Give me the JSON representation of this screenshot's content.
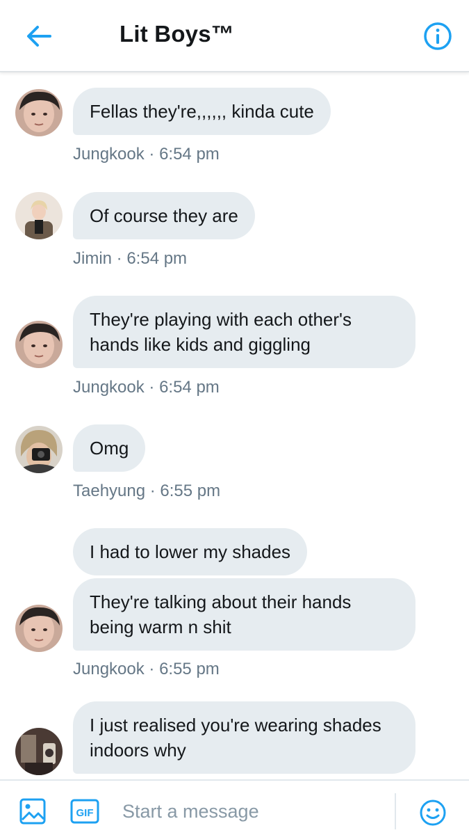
{
  "header": {
    "title": "Lit Boys™",
    "back_icon": "arrow-left-icon",
    "info_icon": "info-circle-icon",
    "accent": "#1da1f2"
  },
  "messages": [
    {
      "bubbles": [
        "Fellas they're,,,,,, kinda cute"
      ],
      "sender": "Jungkook",
      "time": "6:54 pm",
      "meta": "Jungkook · 6:54 pm"
    },
    {
      "bubbles": [
        "Of course they are"
      ],
      "sender": "Jimin",
      "time": "6:54 pm",
      "meta": "Jimin · 6:54 pm"
    },
    {
      "bubbles": [
        "They're playing with each other's\nhands like kids and giggling"
      ],
      "sender": "Jungkook",
      "time": "6:54 pm",
      "meta": "Jungkook · 6:54 pm"
    },
    {
      "bubbles": [
        "Omg"
      ],
      "sender": "Taehyung",
      "time": "6:55 pm",
      "meta": "Taehyung · 6:55 pm"
    },
    {
      "bubbles": [
        "I had to lower my shades",
        "They're talking about their hands\nbeing warm n shit"
      ],
      "sender": "Jungkook",
      "time": "6:55 pm",
      "meta": "Jungkook · 6:55 pm"
    },
    {
      "bubbles": [
        "I just realised you're wearing shades\nindoors why"
      ],
      "sender": "",
      "time": "",
      "meta": ""
    }
  ],
  "composer": {
    "placeholder": "Start a message",
    "gif_label": "GIF",
    "media_icon": "image-icon",
    "emoji_icon": "smiley-icon"
  },
  "colors": {
    "bubble_bg": "#e6ecf0",
    "meta_text": "#657786",
    "placeholder": "#8899a6"
  }
}
